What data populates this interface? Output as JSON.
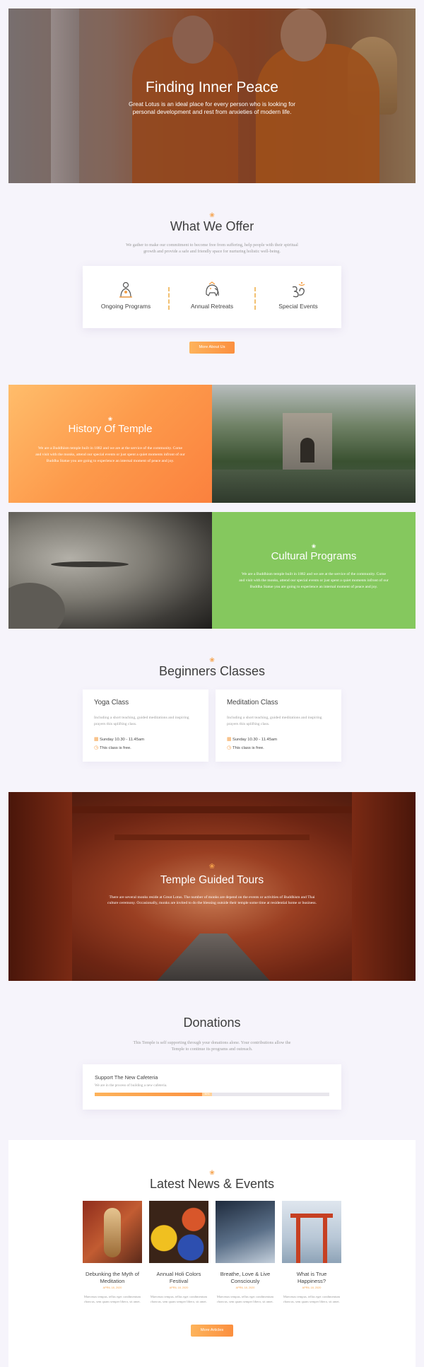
{
  "hero": {
    "title": "Finding Inner Peace",
    "subtitle": "Great Lotus is an ideal place for every person who is looking for personal development and rest from anxieties of modern life."
  },
  "offer": {
    "title": "What We Offer",
    "description": "We gather to make our commitment to become free from suffering, help people with their spiritual growth and provide a safe and friendly space for nurturing holistic well-being.",
    "items": [
      {
        "label": "Ongoing Programs",
        "icon": "meditating-buddha-icon"
      },
      {
        "label": "Annual Retreats",
        "icon": "elephant-icon"
      },
      {
        "label": "Special Events",
        "icon": "om-symbol-icon"
      }
    ],
    "button_label": "More About Us"
  },
  "history": {
    "title": "History Of Temple",
    "text": "We are a Buddhism temple built in 1882 and we are at the service of the community. Come and visit with the monks, attend our special events or just spent a quiet moments infront of our Buddha Statue you are going to experience an internal moment of peace and joy."
  },
  "cultural": {
    "title": "Cultural Programs",
    "text": "We are a Buddhism temple built in 1882 and we are at the service of the community. Come and visit with the monks, attend our special events or just spent a quiet moments infront of our Buddha Statue you are going to experience an internal moment of peace and joy."
  },
  "classes": {
    "title": "Beginners Classes",
    "items": [
      {
        "title": "Yoga Class",
        "description": "Including a short teaching, guided meditations and inspiring prayers this uplifting class.",
        "time": "Sunday 10.30 - 11.45am",
        "price": "This class is free."
      },
      {
        "title": "Meditation Class",
        "description": "Including a short teaching, guided meditations and inspiring prayers this uplifting class.",
        "time": "Sunday 10.30 - 11.45am",
        "price": "This class is free."
      }
    ]
  },
  "tours": {
    "title": "Temple Guided Tours",
    "text": "There are several monks reside at Great Lotus. The number of monks are depend on the events or activities of Buddhism and Thai culture ceremony. Occasionally, monks are invited to do the blessing outside their temple some time at residential home or business."
  },
  "donations": {
    "title": "Donations",
    "description": "This Temple is self supporting through your donations alone. Your contributions allow the Temple to continue its programs and outreach.",
    "campaign_title": "Support The New Cafeteria",
    "campaign_desc": "We are in the process of building a new cafeteria.",
    "progress_label": "50%",
    "progress": 0.5
  },
  "news": {
    "title": "Latest News & Events",
    "items": [
      {
        "title": "Debunking the Myth of Meditation",
        "date": "APRIL 18, 2020",
        "excerpt": "Maecenas tempus, tellus eget condimentum rhoncus, sem quam semper libero, sit amet."
      },
      {
        "title": "Annual Holi Colors Festival",
        "date": "APRIL 18, 2020",
        "excerpt": "Maecenas tempus, tellus eget condimentum rhoncus, sem quam semper libero, sit amet."
      },
      {
        "title": "Breathe, Love & Live Consciously",
        "date": "APRIL 18, 2020",
        "excerpt": "Maecenas tempus, tellus eget condimentum rhoncus, sem quam semper libero, sit amet."
      },
      {
        "title": "What is True Happiness?",
        "date": "APRIL 18, 2020",
        "excerpt": "Maecenas tempus, tellus eget condimentum rhoncus, sem quam semper libero, sit amet."
      }
    ],
    "button_label": "More Articles"
  },
  "colors": {
    "accent": "#fb9a47",
    "green": "#85c85e",
    "background": "#f6f4fb"
  }
}
